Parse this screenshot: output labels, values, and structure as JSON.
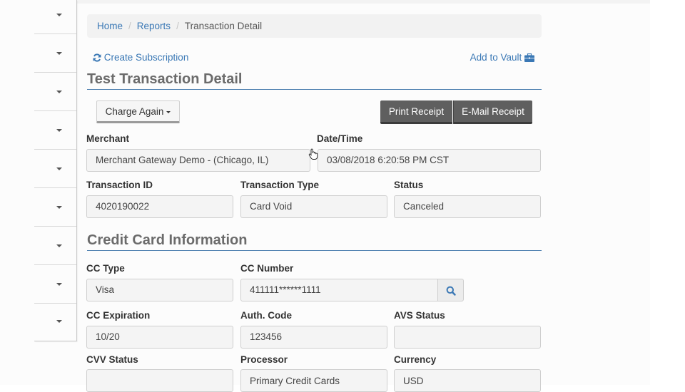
{
  "breadcrumb": {
    "items": [
      {
        "label": "Home"
      },
      {
        "label": "Reports"
      },
      {
        "label": "Transaction Detail"
      }
    ],
    "separator": "/"
  },
  "actions": {
    "create_subscription": "Create Subscription",
    "add_to_vault": "Add to Vault",
    "charge_again": "Charge Again",
    "print_receipt": "Print Receipt",
    "email_receipt": "E-Mail Receipt"
  },
  "sidebar": {
    "items": [
      {
        "icon": "caret-down-icon"
      },
      {
        "icon": "caret-down-icon"
      },
      {
        "icon": "caret-down-icon"
      },
      {
        "icon": "caret-down-icon"
      },
      {
        "icon": "caret-down-icon"
      },
      {
        "icon": "caret-down-icon"
      },
      {
        "icon": "caret-down-icon"
      },
      {
        "icon": "caret-down-icon"
      },
      {
        "icon": "caret-down-icon"
      }
    ]
  },
  "transaction": {
    "title": "Test Transaction Detail",
    "merchant": {
      "label": "Merchant",
      "value": "Merchant Gateway Demo - (Chicago, IL)"
    },
    "datetime": {
      "label": "Date/Time",
      "value": "03/08/2018 6:20:58 PM CST"
    },
    "transaction_id": {
      "label": "Transaction ID",
      "value": "4020190022"
    },
    "transaction_type": {
      "label": "Transaction Type",
      "value": "Card Void"
    },
    "status": {
      "label": "Status",
      "value": "Canceled"
    }
  },
  "credit_card": {
    "title": "Credit Card Information",
    "cc_type": {
      "label": "CC Type",
      "value": "Visa"
    },
    "cc_number": {
      "label": "CC Number",
      "value": "411111******1111"
    },
    "cc_expiration": {
      "label": "CC Expiration",
      "value": "10/20"
    },
    "auth_code": {
      "label": "Auth. Code",
      "value": "123456"
    },
    "avs_status": {
      "label": "AVS Status",
      "value": ""
    },
    "cvv_status": {
      "label": "CVV Status",
      "value": ""
    },
    "processor": {
      "label": "Processor",
      "value": "Primary Credit Cards"
    },
    "currency": {
      "label": "Currency",
      "value": "USD"
    }
  },
  "colors": {
    "link": "#3a78b5",
    "dark_button": "#5f5f5f",
    "section_underline": "#4f81b0"
  }
}
